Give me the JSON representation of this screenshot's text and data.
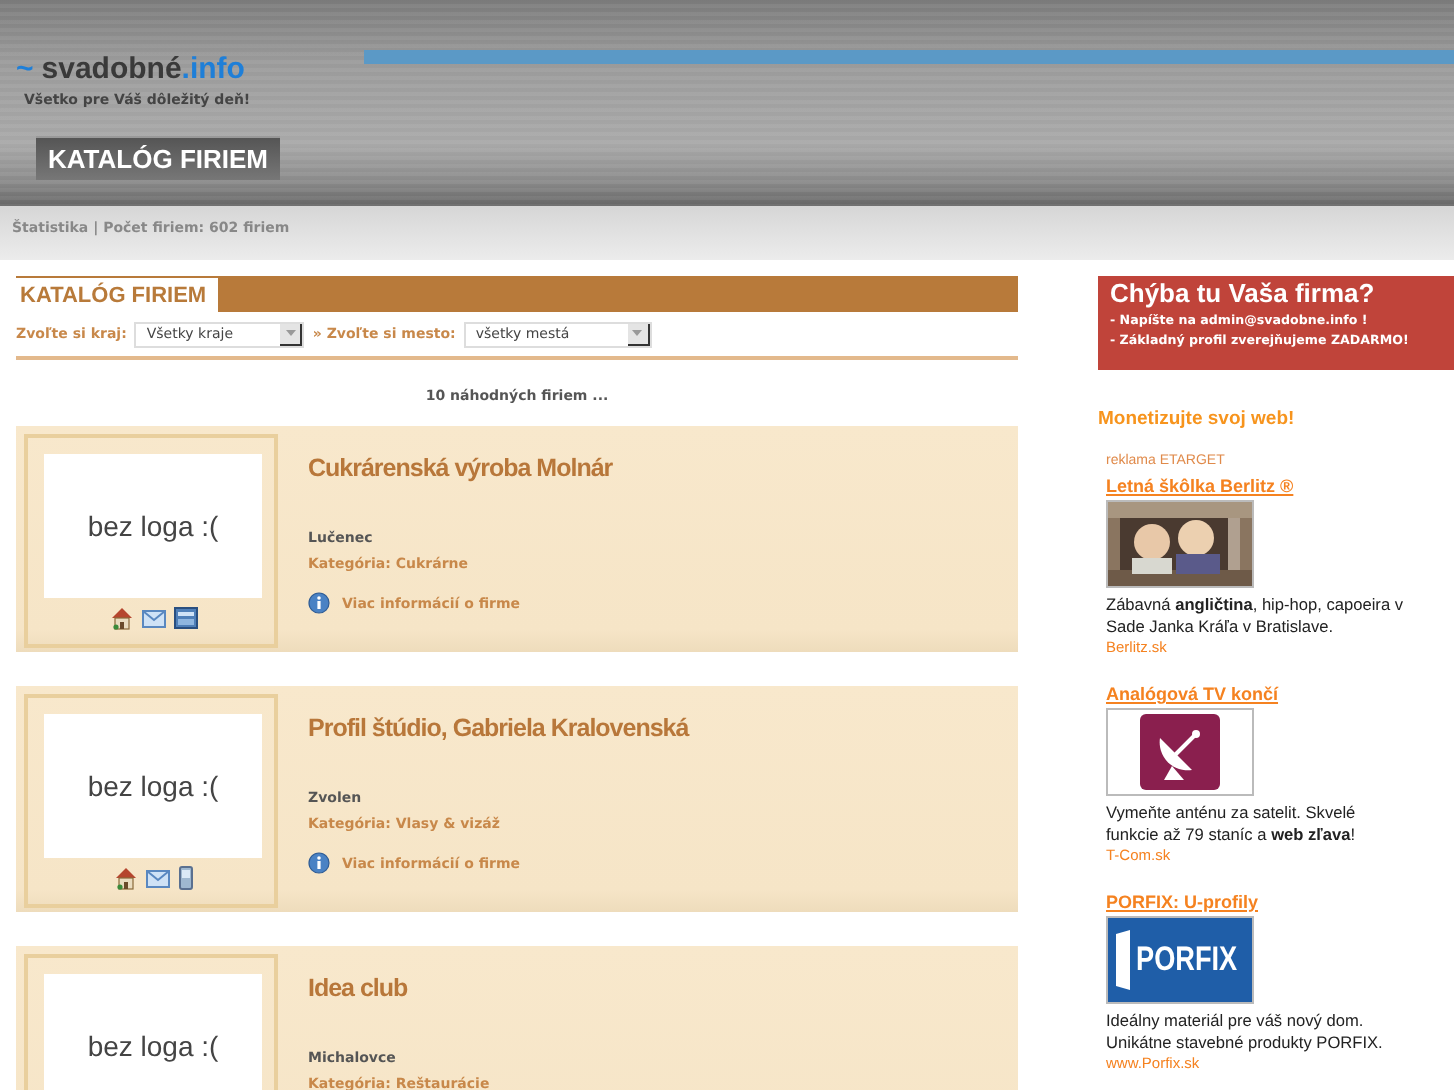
{
  "header": {
    "logo_prefix": "~",
    "logo_main": "svadobné",
    "logo_suffix": ".info",
    "tagline": "Všetko pre Váš dôležitý deň!",
    "nav_tab": "KATALÓG FIRIEM"
  },
  "stats": "Štatistika | Počet firiem: 602 firiem",
  "catalog": {
    "title": "KATALÓG FIRIEM",
    "filters": [
      {
        "label": "Zvoľte si kraj:",
        "value": "Všetky kraje"
      },
      {
        "label": "» Zvoľte si mesto:",
        "value": "všetky mestá"
      }
    ],
    "intro": "10 náhodných firiem ...",
    "firms": [
      {
        "logo": "bez loga :(",
        "name": "Cukrárenská výroba Molnár",
        "city": "Lučenec",
        "category": "Kategória: Cukrárne",
        "more": "Viac informácií o firme",
        "icons": [
          {
            "kind": "home"
          },
          {
            "kind": "mail"
          },
          {
            "kind": "card"
          }
        ]
      },
      {
        "logo": "bez loga :(",
        "name": "Profil štúdio, Gabriela Kralovenská",
        "city": "Zvolen",
        "category": "Kategória: Vlasy & vizáž",
        "more": "Viac informácií o firme",
        "icons": [
          {
            "kind": "home"
          },
          {
            "kind": "mail"
          },
          {
            "kind": "mobile"
          }
        ]
      },
      {
        "logo": "bez loga :(",
        "name": "Idea club",
        "city": "Michalovce",
        "category": "Kategória: Reštaurácie"
      }
    ]
  },
  "sidebar": {
    "promo": {
      "title": "Chýba tu Vaša firma?",
      "lines": [
        "- Napíšte na admin@svadobne.info !",
        "- Základný profil zverejňujeme ZADARMO!"
      ]
    },
    "heading": "Monetizujte svoj web!",
    "ad_label": "reklama ETARGET",
    "ads": [
      {
        "title": "Letná škôlka Berlitz ®",
        "text": "Zábavná **angličtina**, hip-hop, capoeira v Sade Janka Kráľa v Bratislave.",
        "source": "Berlitz.sk"
      },
      {
        "title": "Analógová TV končí",
        "kind": "icon",
        "text": "Vymeňte anténu za satelit. Skvelé funkcie až 79 staníc a **web zľava**!",
        "source": "T-Com.sk"
      },
      {
        "title": "PORFIX: U-profily",
        "kind": "logo",
        "logo_text": "PORFIX",
        "text": "Ideálny materiál pre váš nový dom. Unikátne stavebné produkty PORFIX.",
        "source": "www.Porfix.sk"
      }
    ]
  }
}
